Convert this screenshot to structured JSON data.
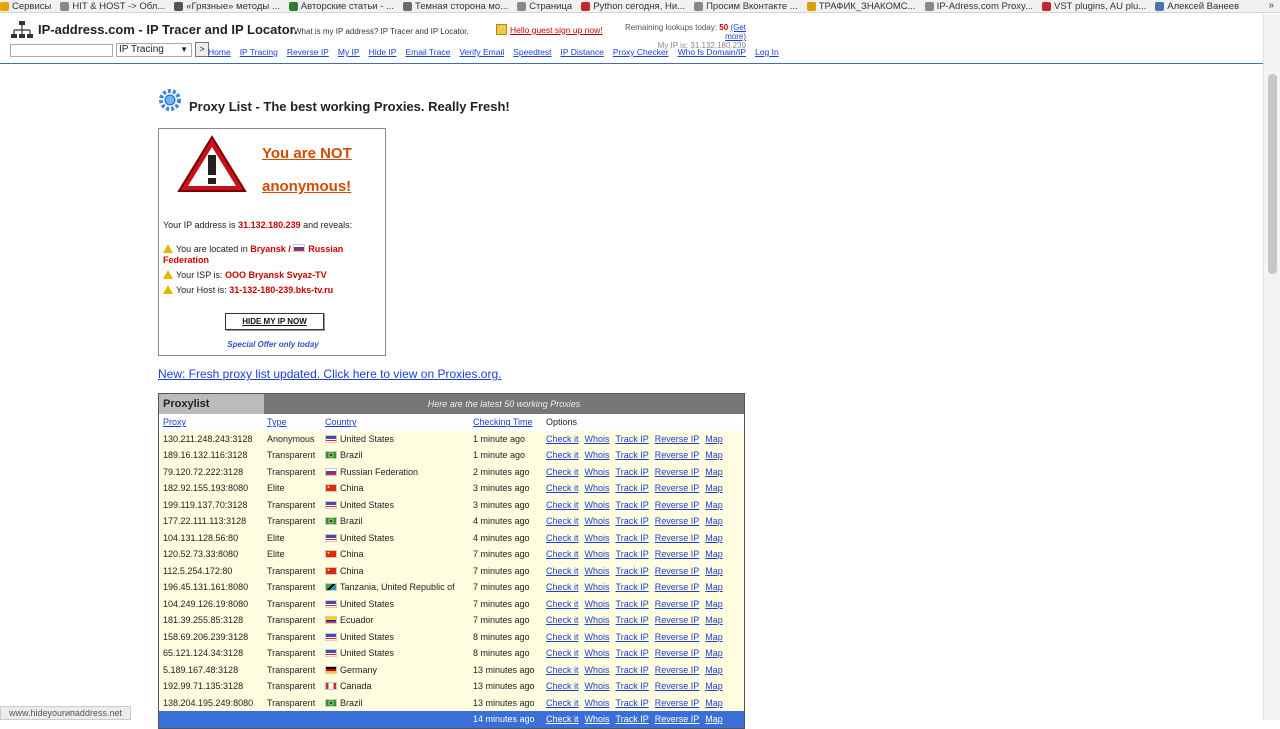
{
  "bookmarks": [
    {
      "label": "Сервисы",
      "color": "#e8a400"
    },
    {
      "label": "HIT & HOST -> Обл...",
      "color": "#888888"
    },
    {
      "label": "«Грязные» методы ...",
      "color": "#555555"
    },
    {
      "label": "Авторские статьи - ...",
      "color": "#2e7d32"
    },
    {
      "label": "Темная сторона мо...",
      "color": "#6a6a6a"
    },
    {
      "label": "Страница",
      "color": "#888888"
    },
    {
      "label": "Python сегодня, Ни...",
      "color": "#c62828"
    },
    {
      "label": "Просим Вконтакте ...",
      "color": "#888888"
    },
    {
      "label": "ТРАФИК_ЗНАКОМС...",
      "color": "#d8a000"
    },
    {
      "label": "IP-Adress.com Proxy...",
      "color": "#888888"
    },
    {
      "label": "VST plugins, AU plu...",
      "color": "#c62828"
    },
    {
      "label": "Алексей Ванеев",
      "color": "#4a76a8"
    }
  ],
  "bookmarks_more": "»",
  "header": {
    "title": "IP-address.com - IP Tracer and IP Locator.",
    "subtitle": "What is my IP address? IP Tracer and IP Locator.",
    "guest_link": "Hello guest sign up now!",
    "lookups_label": "Remaining lookups today:",
    "lookups_count": "50",
    "get_more": "(Get more)",
    "my_ip": "My IP is: 31.132.180.239",
    "search_placeholder": "",
    "search_select": "IP Tracing",
    "go_label": ">"
  },
  "nav": [
    "Home",
    "IP Tracing",
    "Reverse IP",
    "My IP",
    "Hide IP",
    "Email Trace",
    "Verify Email",
    "Speedtest",
    "IP Distance",
    "Proxy Checker",
    "Who Is Domain/IP",
    "Log In"
  ],
  "page": {
    "title": "Proxy List - The best working Proxies. Really Fresh!",
    "not_anon_1": "You are NOT",
    "not_anon_2": "anonymous!",
    "your_ip_prefix": "Your IP address is",
    "your_ip": "31.132.180.239",
    "your_ip_suffix": "and reveals:",
    "located_prefix": "You are located in",
    "located_city": "Bryansk /",
    "located_country_a": "Russian",
    "located_country_b": "Federation",
    "isp_prefix": "Your ISP is:",
    "isp": "OOO Bryansk Svyaz-TV",
    "host_prefix": "Your Host is:",
    "host": "31-132-180-239.bks-tv.ru",
    "hide_button": "HIDE MY IP NOW",
    "special_offer": "Special Offer only today",
    "fresh_link": "New: Fresh proxy list updated. Click here to view on Proxies.org."
  },
  "table": {
    "title": "Proxylist",
    "caption": "Here are the latest 50 working Proxies",
    "headers": {
      "proxy": "Proxy",
      "type": "Type",
      "country": "Country",
      "time": "Checking Time",
      "options": "Options"
    },
    "options": [
      "Check it",
      "Whois",
      "Track IP",
      "Reverse IP",
      "Map"
    ],
    "rows": [
      {
        "proxy": "130.211.248.243:3128",
        "type": "Anonymous",
        "country": "United States",
        "flag": "us",
        "time": "1 minute ago"
      },
      {
        "proxy": "189.16.132.116:3128",
        "type": "Transparent",
        "country": "Brazil",
        "flag": "br",
        "time": "1 minute ago"
      },
      {
        "proxy": "79.120.72.222:3128",
        "type": "Transparent",
        "country": "Russian Federation",
        "flag": "ru",
        "time": "2 minutes ago"
      },
      {
        "proxy": "182.92.155.193:8080",
        "type": "Elite",
        "country": "China",
        "flag": "cn",
        "time": "3 minutes ago"
      },
      {
        "proxy": "199.119.137.70:3128",
        "type": "Transparent",
        "country": "United States",
        "flag": "us",
        "time": "3 minutes ago"
      },
      {
        "proxy": "177.22.111.113:3128",
        "type": "Transparent",
        "country": "Brazil",
        "flag": "br",
        "time": "4 minutes ago"
      },
      {
        "proxy": "104.131.128.56:80",
        "type": "Elite",
        "country": "United States",
        "flag": "us",
        "time": "4 minutes ago"
      },
      {
        "proxy": "120.52.73.33:8080",
        "type": "Elite",
        "country": "China",
        "flag": "cn",
        "time": "7 minutes ago"
      },
      {
        "proxy": "112.5.254.172:80",
        "type": "Transparent",
        "country": "China",
        "flag": "cn",
        "time": "7 minutes ago"
      },
      {
        "proxy": "196.45.131.161:8080",
        "type": "Transparent",
        "country": "Tanzania, United Republic of",
        "flag": "tz",
        "time": "7 minutes ago"
      },
      {
        "proxy": "104.249.126.19:8080",
        "type": "Transparent",
        "country": "United States",
        "flag": "us",
        "time": "7 minutes ago"
      },
      {
        "proxy": "181.39.255.85:3128",
        "type": "Transparent",
        "country": "Ecuador",
        "flag": "ec",
        "time": "7 minutes ago"
      },
      {
        "proxy": "158.69.206.239:3128",
        "type": "Transparent",
        "country": "United States",
        "flag": "us",
        "time": "8 minutes ago"
      },
      {
        "proxy": "65.121.124.34:3128",
        "type": "Transparent",
        "country": "United States",
        "flag": "us",
        "time": "8 minutes ago"
      },
      {
        "proxy": "5.189.167.48:3128",
        "type": "Transparent",
        "country": "Germany",
        "flag": "de",
        "time": "13 minutes ago"
      },
      {
        "proxy": "192.99.71.135:3128",
        "type": "Transparent",
        "country": "Canada",
        "flag": "ca",
        "time": "13 minutes ago"
      },
      {
        "proxy": "138.204.195.249:8080",
        "type": "Transparent",
        "country": "Brazil",
        "flag": "br",
        "time": "13 minutes ago"
      },
      {
        "proxy": "",
        "type": "",
        "country": "",
        "flag": "",
        "time": "14 minutes ago",
        "selected": true
      }
    ]
  },
  "status_url": "www.hideyourипaddress.net"
}
